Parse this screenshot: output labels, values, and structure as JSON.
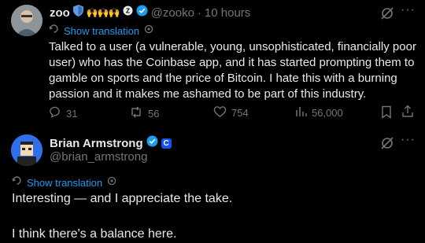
{
  "tweet1": {
    "name": "zoo",
    "handle": "@zooko",
    "dot": "·",
    "time": "10 hours",
    "show_translation": "Show translation",
    "text": "Talked to a user (a vulnerable, young, unsophisticated, financially poor user) who has the Coinbase app, and it has started prompting them to gamble on sports and the price of Bitcoin. I hate this with a burning passion and it makes me ashamed to be part of this industry.",
    "replies": "31",
    "reposts": "56",
    "likes": "754",
    "views": "56,000"
  },
  "tweet2": {
    "name": "Brian Armstrong",
    "handle": "@brian_armstrong",
    "show_translation": "Show translation",
    "line1": "Interesting — and I appreciate the take.",
    "line2": "I think there's a balance here."
  },
  "colors": {
    "background": "#000000",
    "text": "#e7e9ea",
    "muted": "#71767b",
    "accent": "#1d9bf0"
  },
  "icons": [
    "shield-icon",
    "hands-emoji-icons",
    "verified-badge-icon",
    "grok-icon",
    "more-icon",
    "translate-gear-icon",
    "reply-icon",
    "repost-icon",
    "like-icon",
    "views-icon",
    "bookmark-icon",
    "share-icon",
    "coinbase-badge-icon"
  ]
}
